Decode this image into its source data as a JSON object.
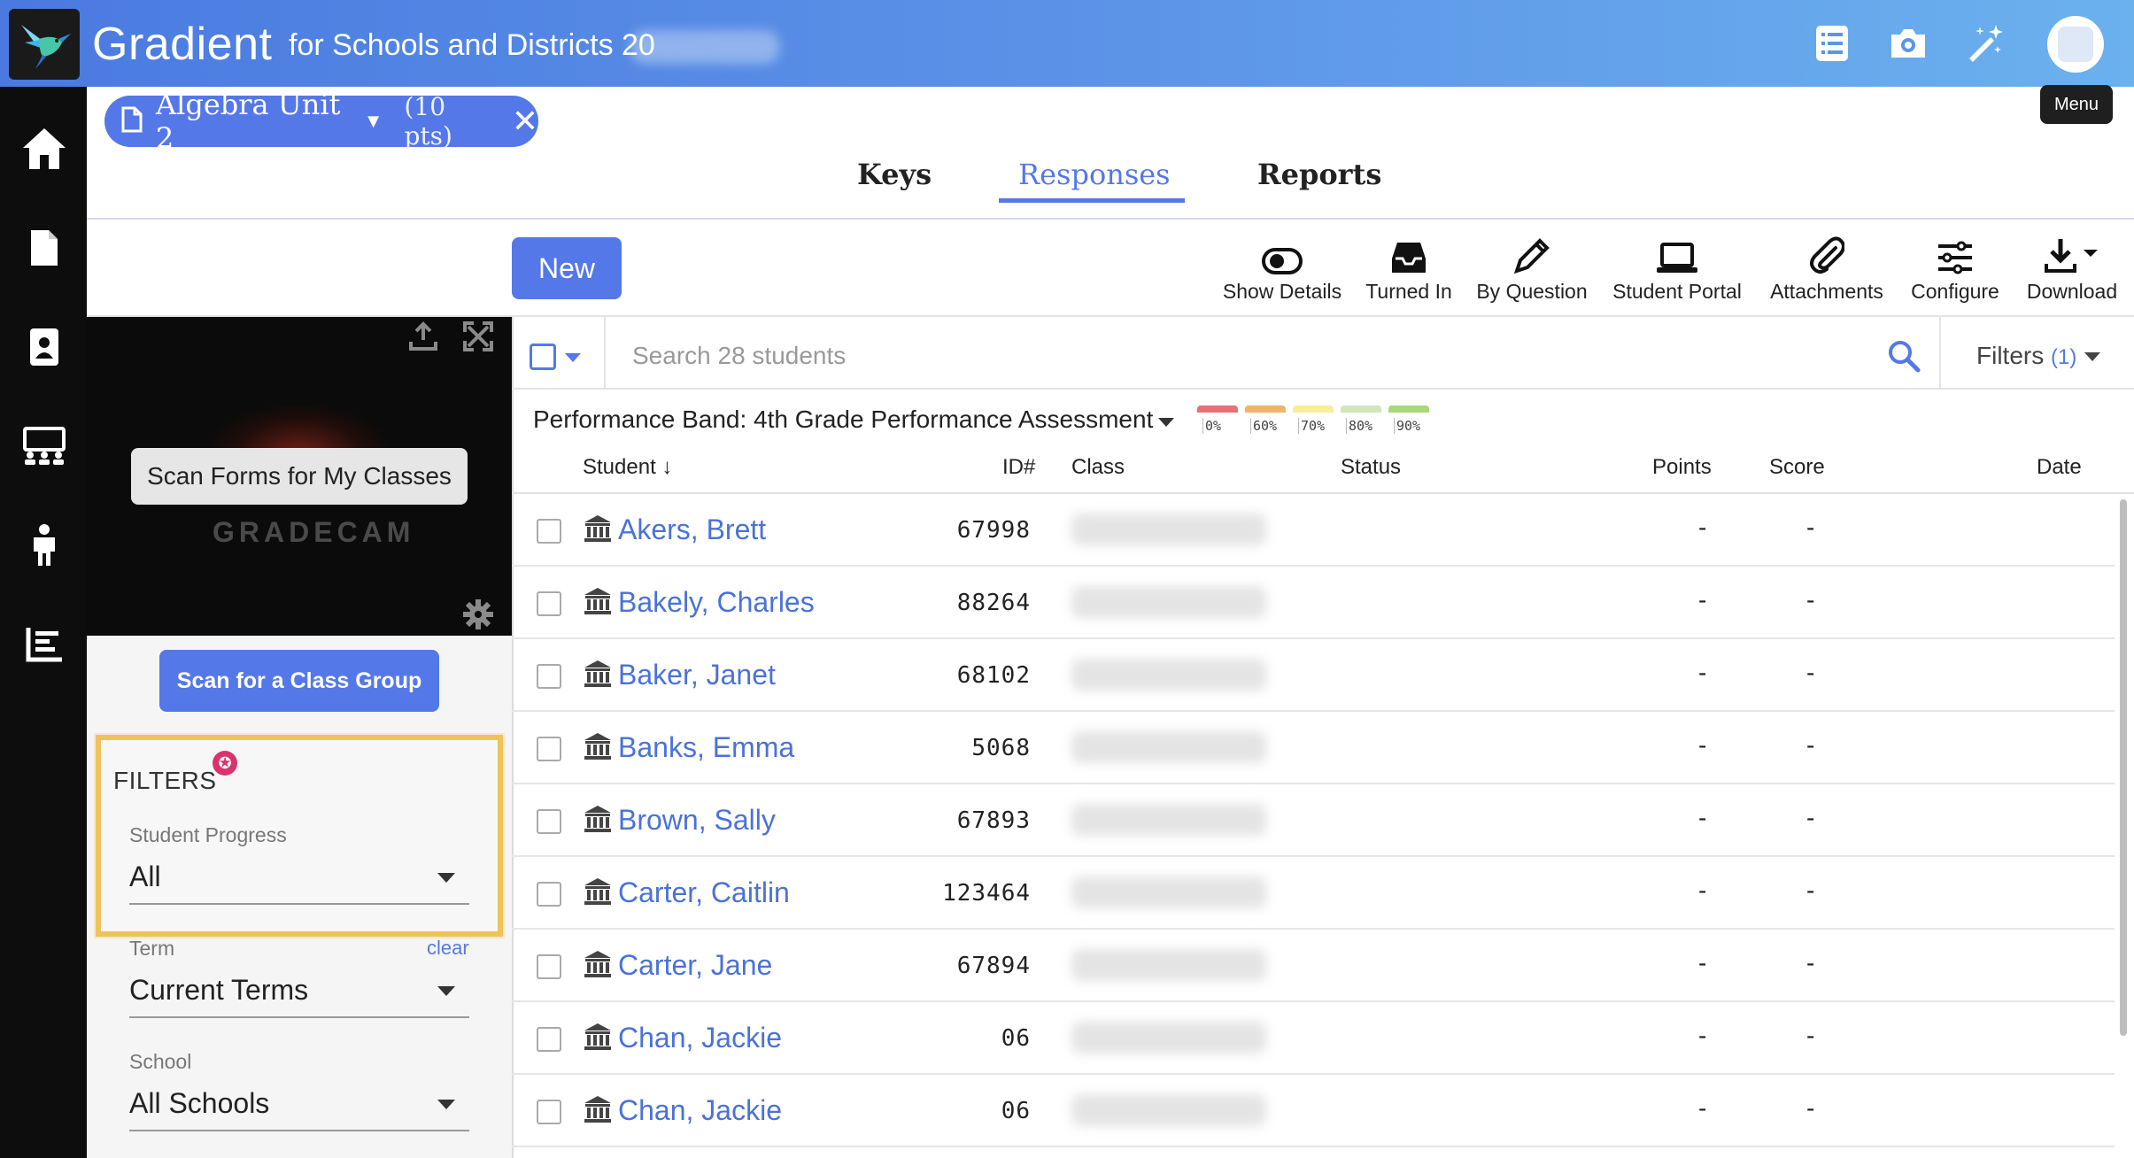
{
  "header": {
    "brand": "Gradient",
    "subtitle": "for Schools and Districts 20",
    "menu_tooltip": "Menu",
    "icons": [
      "list-icon",
      "camera-icon",
      "magic-wand-icon",
      "avatar"
    ]
  },
  "sidebar": {
    "items": [
      "home-icon",
      "document-icon",
      "id-badge-icon",
      "classroom-icon",
      "student-icon",
      "reports-chart-icon"
    ]
  },
  "assignment": {
    "title": "Algebra Unit 2",
    "points": "(10 pts)"
  },
  "tabs": [
    {
      "label": "Keys"
    },
    {
      "label": "Responses",
      "active": true
    },
    {
      "label": "Reports"
    }
  ],
  "toolbar": {
    "new_label": "New",
    "tools": [
      {
        "label": "Show Details",
        "icon": "toggle-icon"
      },
      {
        "label": "Turned In",
        "icon": "inbox-icon"
      },
      {
        "label": "By Question",
        "icon": "pencil-icon"
      },
      {
        "label": "Student Portal",
        "icon": "laptop-icon"
      },
      {
        "label": "Attachments",
        "icon": "paperclip-icon"
      },
      {
        "label": "Configure",
        "icon": "sliders-icon"
      },
      {
        "label": "Download",
        "icon": "download-icon"
      }
    ]
  },
  "scanner": {
    "scan_forms_label": "Scan Forms for My Classes",
    "watermark": "GRADECAM",
    "scan_group_label": "Scan for a Class Group"
  },
  "filters_panel": {
    "title": "FILTERS",
    "student_progress": {
      "label": "Student Progress",
      "value": "All"
    },
    "term": {
      "label": "Term",
      "value": "Current Terms",
      "clear": "clear"
    },
    "school": {
      "label": "School",
      "value": "All Schools"
    }
  },
  "search": {
    "placeholder": "Search 28 students",
    "filters_label": "Filters",
    "filters_count": "(1)"
  },
  "performance_band": {
    "label": "Performance Band: 4th Grade Performance Assessment",
    "bands": [
      {
        "label": "0%",
        "color": "#e57373"
      },
      {
        "label": "60%",
        "color": "#efb36a"
      },
      {
        "label": "70%",
        "color": "#f6ee9a"
      },
      {
        "label": "80%",
        "color": "#cfe7b8"
      },
      {
        "label": "90%",
        "color": "#a9d77a"
      }
    ]
  },
  "table": {
    "columns": {
      "student": "Student",
      "id": "ID#",
      "class": "Class",
      "status": "Status",
      "points": "Points",
      "score": "Score",
      "date": "Date"
    },
    "rows": [
      {
        "name": "Akers, Brett",
        "id": "67998",
        "points": "-",
        "score": "-"
      },
      {
        "name": "Bakely, Charles",
        "id": "88264",
        "points": "-",
        "score": "-"
      },
      {
        "name": "Baker, Janet",
        "id": "68102",
        "points": "-",
        "score": "-"
      },
      {
        "name": "Banks, Emma",
        "id": "5068",
        "points": "-",
        "score": "-"
      },
      {
        "name": "Brown, Sally",
        "id": "67893",
        "points": "-",
        "score": "-"
      },
      {
        "name": "Carter, Caitlin",
        "id": "123464",
        "points": "-",
        "score": "-"
      },
      {
        "name": "Carter, Jane",
        "id": "67894",
        "points": "-",
        "score": "-"
      },
      {
        "name": "Chan, Jackie",
        "id": "06",
        "points": "-",
        "score": "-"
      },
      {
        "name": "Chan, Jackie",
        "id": "06",
        "points": "-",
        "score": "-"
      }
    ]
  }
}
